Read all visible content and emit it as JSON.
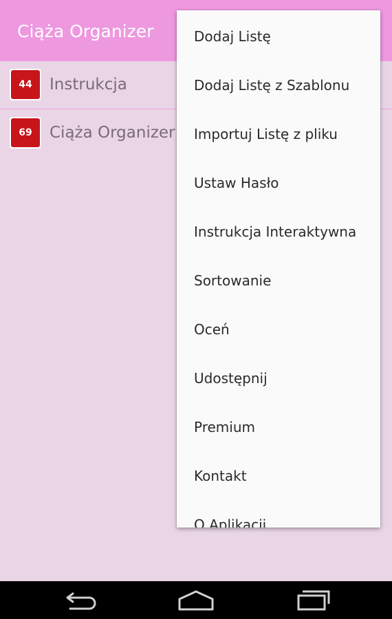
{
  "app": {
    "title": "Ciąża Organizer",
    "bar_color": "#ee98e0",
    "background_color": "#e9d5e6"
  },
  "lists": [
    {
      "count": "44",
      "name": "Instrukcja"
    },
    {
      "count": "69",
      "name": "Ciąża Organizer"
    }
  ],
  "badge_color": "#c8141b",
  "menu": {
    "items": [
      "Dodaj Listę",
      "Dodaj Listę z Szablonu",
      "Importuj Listę z pliku",
      "Ustaw Hasło",
      "Instrukcja Interaktywna",
      "Sortowanie",
      "Oceń",
      "Udostępnij",
      "Premium",
      "Kontakt",
      "O Aplikacji"
    ]
  },
  "navigation": {
    "icons": [
      "back-icon",
      "home-icon",
      "recent-apps-icon"
    ]
  }
}
